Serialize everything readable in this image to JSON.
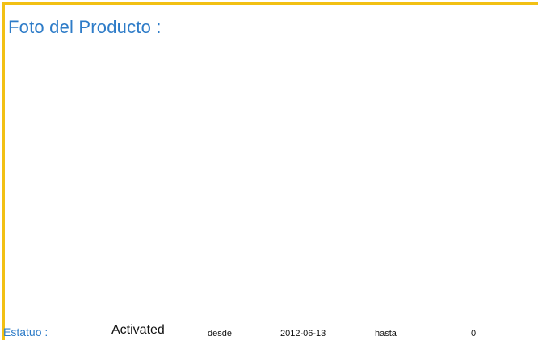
{
  "panel": {
    "title": "Foto del Producto :",
    "accent_color": "#f2c014",
    "title_color": "#2e7cc8"
  },
  "status": {
    "label": "Estatuo :",
    "value": "Activated",
    "since_label": "desde",
    "since_date": "2012-06-13",
    "until_label": "hasta",
    "until_value": "0"
  }
}
